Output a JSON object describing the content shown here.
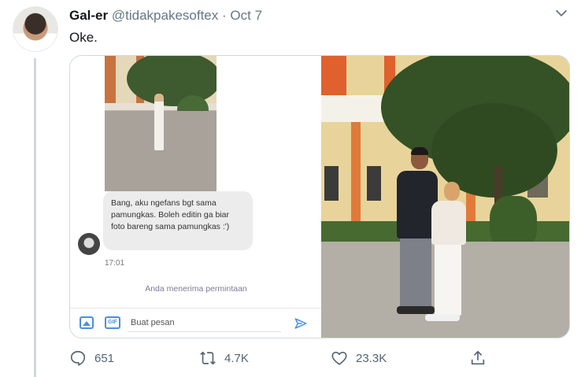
{
  "tweet": {
    "display_name": "Gal-er",
    "handle": "@tidakpakesoftex",
    "separator": "·",
    "date": "Oct 7",
    "text": "Oke.",
    "stats": {
      "replies": "651",
      "retweets": "4.7K",
      "likes": "23.3K"
    }
  },
  "media": {
    "chat_screenshot": {
      "message": "Bang, aku ngefans bgt sama pamungkas. Boleh editin ga biar foto bareng sama pamungkas :')",
      "time": "17:01",
      "notice": "Anda menerima permintaan",
      "input_placeholder": "Buat pesan",
      "gif_label": "GIF"
    }
  },
  "colors": {
    "text_primary": "#14171a",
    "text_secondary": "#657786",
    "border": "#cfd9de",
    "accent_blue": "#4a8fe0"
  },
  "icons": {
    "menu": "chevron-down-icon",
    "reply": "reply-icon",
    "retweet": "retweet-icon",
    "like": "heart-icon",
    "share": "share-icon"
  }
}
